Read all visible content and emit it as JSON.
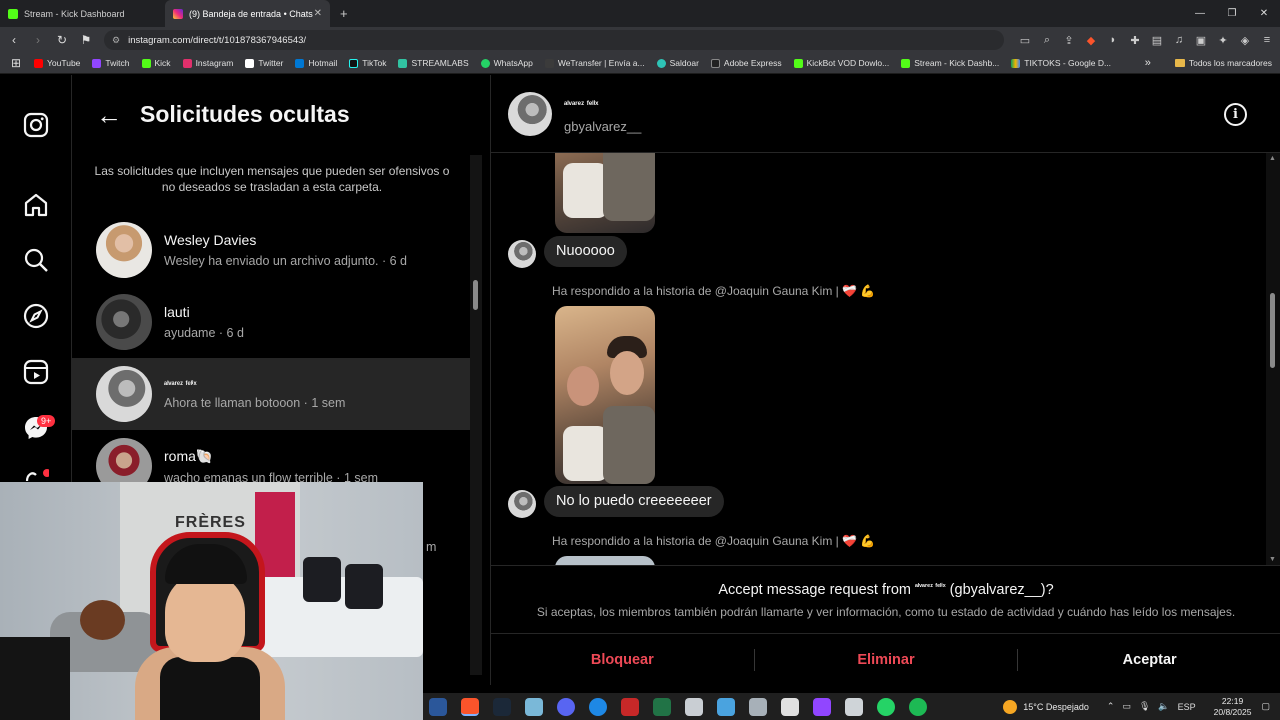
{
  "browser": {
    "tabs": [
      {
        "title": "Stream - Kick Dashboard",
        "active": false
      },
      {
        "title": "(9) Bandeja de entrada • Chats",
        "active": true
      }
    ],
    "url": "instagram.com/direct/t/101878367946543/",
    "bookmarks": [
      "YouTube",
      "Twitch",
      "Kick",
      "Instagram",
      "Twitter",
      "Hotmail",
      "TikTok",
      "STREAMLABS",
      "WhatsApp",
      "WeTransfer | Envía a...",
      "Saldoar",
      "Adobe Express",
      "KickBot VOD Dowlo...",
      "Stream - Kick Dashb...",
      "TIKTOKS - Google D..."
    ],
    "bookmarks_folder": "Todos los marcadores",
    "overflow": "»"
  },
  "rail": {
    "badge": "9+"
  },
  "list": {
    "title": "Solicitudes ocultas",
    "info": "Las solicitudes que incluyen mensajes que pueden ser ofensivos o no deseados se trasladan a esta carpeta.",
    "conversations": [
      {
        "name": "Wesley Davies",
        "preview": "Wesley ha enviado un archivo adjunto. · 6 d"
      },
      {
        "name": "lauti",
        "preview": "ayudame · 6 d"
      },
      {
        "name": "ᵃˡᵛᵃʳᵉᶻ ᶠᵉˡⁱˣ",
        "preview": "Ahora te llaman botooon · 1 sem"
      },
      {
        "name": "roma🐚",
        "preview": "wacho emanas un flow terrible · 1 sem"
      }
    ],
    "hidden_fragment": "m"
  },
  "webcam": {
    "poster_text": "FRÈRES"
  },
  "chat": {
    "name": "ᵃˡᵛᵃʳᵉᶻ ᶠᵉˡⁱˣ",
    "handle": "gbyalvarez__",
    "messages": [
      {
        "type": "text",
        "text": "Nuooooo"
      },
      {
        "type": "story_reply",
        "note": "Ha respondido a la historia de @Joaquin Gauna Kim | ",
        "emoji": "❤‍🩹 💪"
      },
      {
        "type": "text",
        "text": "No lo puedo creeeeeeer"
      },
      {
        "type": "story_reply",
        "note": "Ha respondido a la historia de @Joaquin Gauna Kim | ",
        "emoji": "❤‍🩹 💪"
      }
    ],
    "request": {
      "title_prefix": "Accept message request from ",
      "title_name": "ᵃˡᵛᵃʳᵉᶻ ᶠᵉˡⁱˣ",
      "title_suffix": " (gbyalvarez__)?",
      "description": "Si aceptas, los miembros también podrán llamarte y ver información, como tu estado de actividad y cuándo has leído los mensajes."
    },
    "actions": {
      "block": "Bloquear",
      "delete": "Eliminar",
      "accept": "Aceptar"
    }
  },
  "taskbar": {
    "weather": "15°C  Despejado",
    "lang": "ESP",
    "time": "22:19",
    "date": "20/8/2025"
  },
  "colors": {
    "accent_red": "#ed4956",
    "badge": "#ff3040",
    "kick_green": "#53fc18"
  }
}
